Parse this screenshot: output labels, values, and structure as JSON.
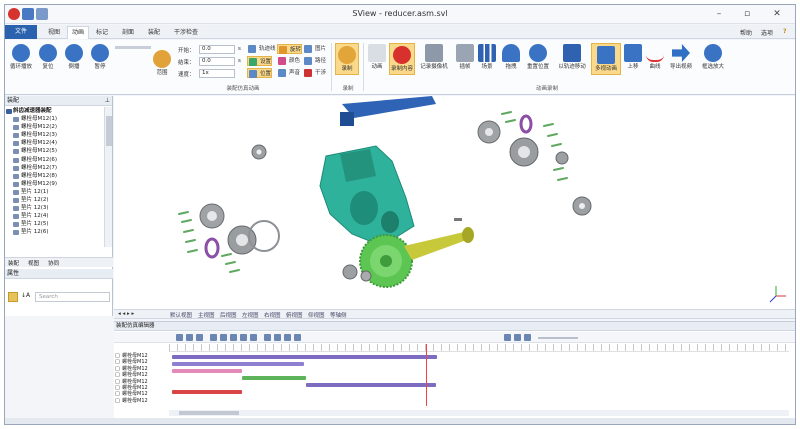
{
  "window": {
    "title": "SView - reducer.asm.svl",
    "help_label": "帮助",
    "options_label": "选项",
    "help_glyph": "?"
  },
  "tabs": [
    {
      "label": "文件"
    },
    {
      "label": "视图"
    },
    {
      "label": "动画"
    },
    {
      "label": "标记"
    },
    {
      "label": "剖面"
    },
    {
      "label": "装配"
    },
    {
      "label": "干涉检查"
    }
  ],
  "ribbon": {
    "playback": [
      {
        "label": "循环播放"
      },
      {
        "label": "复位"
      },
      {
        "label": "倒播"
      },
      {
        "label": "暂停"
      }
    ],
    "scope_label": "范围",
    "start_label": "开始：",
    "start_value": "0.0",
    "end_label": "结束：",
    "end_value": "0.0",
    "speed_label": "速度：",
    "speed_value": "1x",
    "unit_s": "s",
    "small_buttons": [
      {
        "label": "轨迹线"
      },
      {
        "label": "旋转"
      },
      {
        "label": "图片"
      },
      {
        "label": "设置"
      },
      {
        "label": "颜色"
      },
      {
        "label": "路径"
      },
      {
        "label": "位置"
      },
      {
        "label": "声音"
      },
      {
        "label": "干涉"
      }
    ],
    "group_sim": "装配仿真动画",
    "record_label": "录制",
    "group_record": "录制",
    "anim_buttons": [
      {
        "label": "动画"
      },
      {
        "label": "录制内容"
      },
      {
        "label": "记录摄像机"
      },
      {
        "label": "插帧"
      },
      {
        "label": "场景"
      },
      {
        "label": "拖拽"
      },
      {
        "label": "重置位置"
      },
      {
        "label": "以轨迹移动"
      },
      {
        "label": "多视动画"
      },
      {
        "label": "上移"
      },
      {
        "label": "曲线"
      },
      {
        "label": "导出视频"
      },
      {
        "label": "框选放大"
      }
    ],
    "group_anim": "动画录制"
  },
  "left_panel": {
    "title": "装配",
    "root": "斜齿减速器装配",
    "items": [
      "螺栓母M12(1)",
      "螺栓母M12(2)",
      "螺栓母M12(3)",
      "螺栓母M12(4)",
      "螺栓母M12(5)",
      "螺栓母M12(6)",
      "螺栓母M12(7)",
      "螺栓母M12(8)",
      "螺栓母M12(9)",
      "垫片 12(1)",
      "垫片 12(2)",
      "垫片 12(3)",
      "垫片 12(4)",
      "垫片 12(5)",
      "垫片 12(6)"
    ],
    "tabs": [
      "装配",
      "视图",
      "协同"
    ],
    "props_title": "属性",
    "search_placeholder": "Search",
    "pin_glyph": "⊥",
    "sort_glyph": "↓A"
  },
  "view_tabs": [
    "默认视图",
    "主视图",
    "后视图",
    "左视图",
    "右视图",
    "俯视图",
    "仰视图",
    "等轴侧"
  ],
  "timeline": {
    "title": "装配仿真编辑器",
    "rows": [
      "螺栓母M12",
      "螺栓母M12",
      "螺栓母M12",
      "螺栓母M12",
      "螺栓母M12",
      "螺栓母M12",
      "螺栓母M12",
      "螺栓母M12"
    ]
  },
  "colors": {
    "accent": "#2b62b0",
    "housing": "#2bb394",
    "gear": "#5fc653",
    "shaft": "#c7c83a",
    "shaft_blue": "#2b5fb0",
    "ring": "#8b4fa6",
    "bearing": "#8f9294",
    "bar_purple": "#7d6cc1",
    "bar_pink": "#e38ab9",
    "bar_green": "#5db35a",
    "bar_red": "#d94545"
  },
  "icons": [
    "play-loop-icon",
    "reset-icon",
    "rewind-icon",
    "pause-icon",
    "record-icon",
    "camera-icon",
    "chart-icon",
    "arrow-icon",
    "zoom-icon"
  ]
}
